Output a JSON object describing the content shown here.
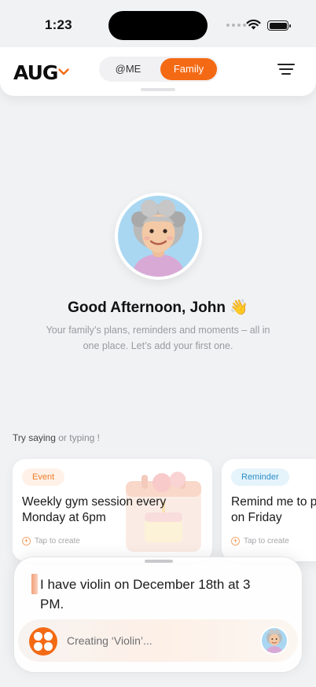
{
  "status": {
    "time": "1:23"
  },
  "header": {
    "month": "AUG",
    "segments": [
      {
        "label": "@ME",
        "selected": false
      },
      {
        "label": "Family",
        "selected": true
      }
    ],
    "accent": "#f46a14"
  },
  "greeting": {
    "title": "Good Afternoon, John 👋",
    "subtitle": "Your family’s plans, reminders and moments – all in one place. Let’s add your first one."
  },
  "prompt_hint": {
    "try": "Try saying",
    "or": "or",
    "typing": "typing !"
  },
  "suggestions": [
    {
      "tag": "Event",
      "title_line1": "Weekly gym session every",
      "title_line2": "Monday at 6pm",
      "action": "Tap to create"
    },
    {
      "tag": "Reminder",
      "title_line1": "Remind me to p",
      "title_line2": "on Friday",
      "action": "Tap to create"
    }
  ],
  "composer": {
    "transcript": "I have violin on December 18th at 3 PM.",
    "status": "Creating ‘Violin’..."
  }
}
